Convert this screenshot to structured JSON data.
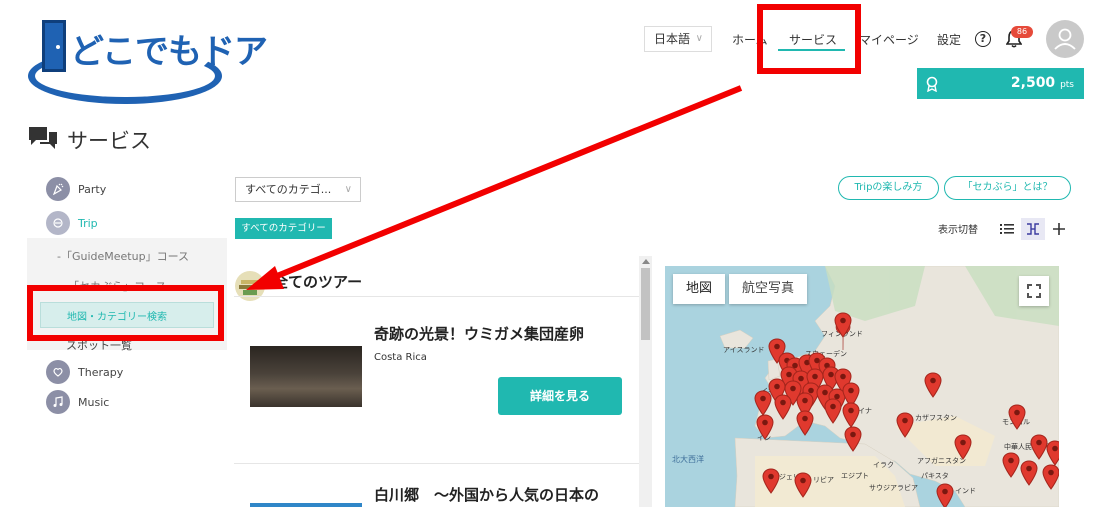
{
  "logo": {
    "text": "どこでもドア"
  },
  "header": {
    "language": "日本語",
    "nav": {
      "home": "ホーム",
      "service": "サービス",
      "mypage": "マイページ",
      "settings": "設定"
    },
    "notification_count": "86",
    "points": "2,500",
    "points_unit": "pts"
  },
  "page": {
    "title": "サービス"
  },
  "sidebar": {
    "categories": [
      {
        "label": "Party"
      },
      {
        "label": "Trip"
      },
      {
        "label": "Therapy"
      },
      {
        "label": "Music"
      }
    ],
    "trip_subitems": [
      {
        "label": "-「GuideMeetup」コース"
      },
      {
        "label": "-「セカぶら」コース"
      },
      {
        "label": "地図・カテゴリー検索"
      },
      {
        "label": "スポット一覧"
      }
    ]
  },
  "filters": {
    "category_select": "すべてのカテゴ...",
    "category_tag": "すべてのカテゴリー",
    "btn_trip_howto": "Tripの楽しみ方",
    "btn_sekabura": "「セカぶら」とは？",
    "view_switch_label": "表示切替"
  },
  "list": {
    "title": "全てのツアー",
    "tours": [
      {
        "title": "奇跡の光景！ウミガメ集団産卵",
        "location": "Costa Rica",
        "button": "詳細を見る"
      },
      {
        "title": "白川郷　～外国から人気の日本の"
      }
    ]
  },
  "map": {
    "tab_map": "地図",
    "tab_aerial": "航空写真",
    "labels": {
      "iceland": "アイスランド",
      "finland": "フィンランド",
      "sweden": "スウェーデン",
      "uk": "イギリ",
      "ukraine": "ライナ",
      "kazakhstan": "カザフスタン",
      "mongolia": "モンゴル",
      "china": "中華人民共和国",
      "spain": "イン",
      "atlantic": "北大西洋",
      "algeria": "アルジェリア",
      "libya": "リビア",
      "egypt": "エジプト",
      "iraq": "イラク",
      "afghanistan": "アフガニスタン",
      "pakistan": "パキスタ",
      "saudi": "サウジアラビア",
      "india": "インド"
    }
  },
  "colors": {
    "accent": "#20b8b0",
    "annotation": "#f20000",
    "logo_blue": "#1f62b3"
  }
}
